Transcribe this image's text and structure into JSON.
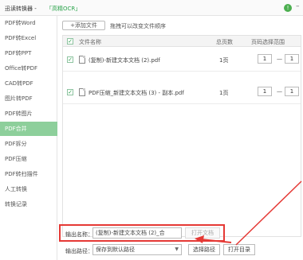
{
  "titlebar": {
    "app_name": "迅读转换器 -",
    "ocr_link": "「高精OCR」",
    "info_symbol": "!",
    "minimize_symbol": "–"
  },
  "sidebar": {
    "items": [
      {
        "label": "PDF转Word"
      },
      {
        "label": "PDF转Excel"
      },
      {
        "label": "PDF转PPT"
      },
      {
        "label": "Office转PDF"
      },
      {
        "label": "CAD转PDF"
      },
      {
        "label": "图片转PDF"
      },
      {
        "label": "PDF转图片"
      },
      {
        "label": "PDF合并"
      },
      {
        "label": "PDF拆分"
      },
      {
        "label": "PDF压缩"
      },
      {
        "label": "PDF转扫描件"
      },
      {
        "label": "人工转换"
      },
      {
        "label": "转换记录"
      }
    ],
    "active_index": 7
  },
  "toolbar": {
    "add_file_label": "+添加文件",
    "hint_text": "拖拽可以改变文件顺序"
  },
  "table": {
    "headers": {
      "name": "文件名称",
      "pages": "总页数",
      "range": "页码选择范围"
    },
    "rows": [
      {
        "name": "(复制)-新建文本文档 (2).pdf",
        "pages": "1页",
        "from": "1",
        "to": "1",
        "checked": true
      },
      {
        "name": "PDF压缩_新建文本文档 (3) - 副本.pdf",
        "pages": "1页",
        "from": "1",
        "to": "1",
        "checked": true
      }
    ],
    "range_separator": "一"
  },
  "output": {
    "name_label": "输出名称：",
    "name_value": "(复制)-新建文本文档 (2)_合",
    "open_doc_label": "打开文档",
    "path_label": "输出路径：",
    "path_value": "保存到默认路径",
    "choose_path_label": "选择路径",
    "open_dir_label": "打开目录"
  },
  "colors": {
    "accent_green": "#2aa44b",
    "active_sidebar": "#8dcf9b",
    "highlight_red": "#e53935"
  }
}
